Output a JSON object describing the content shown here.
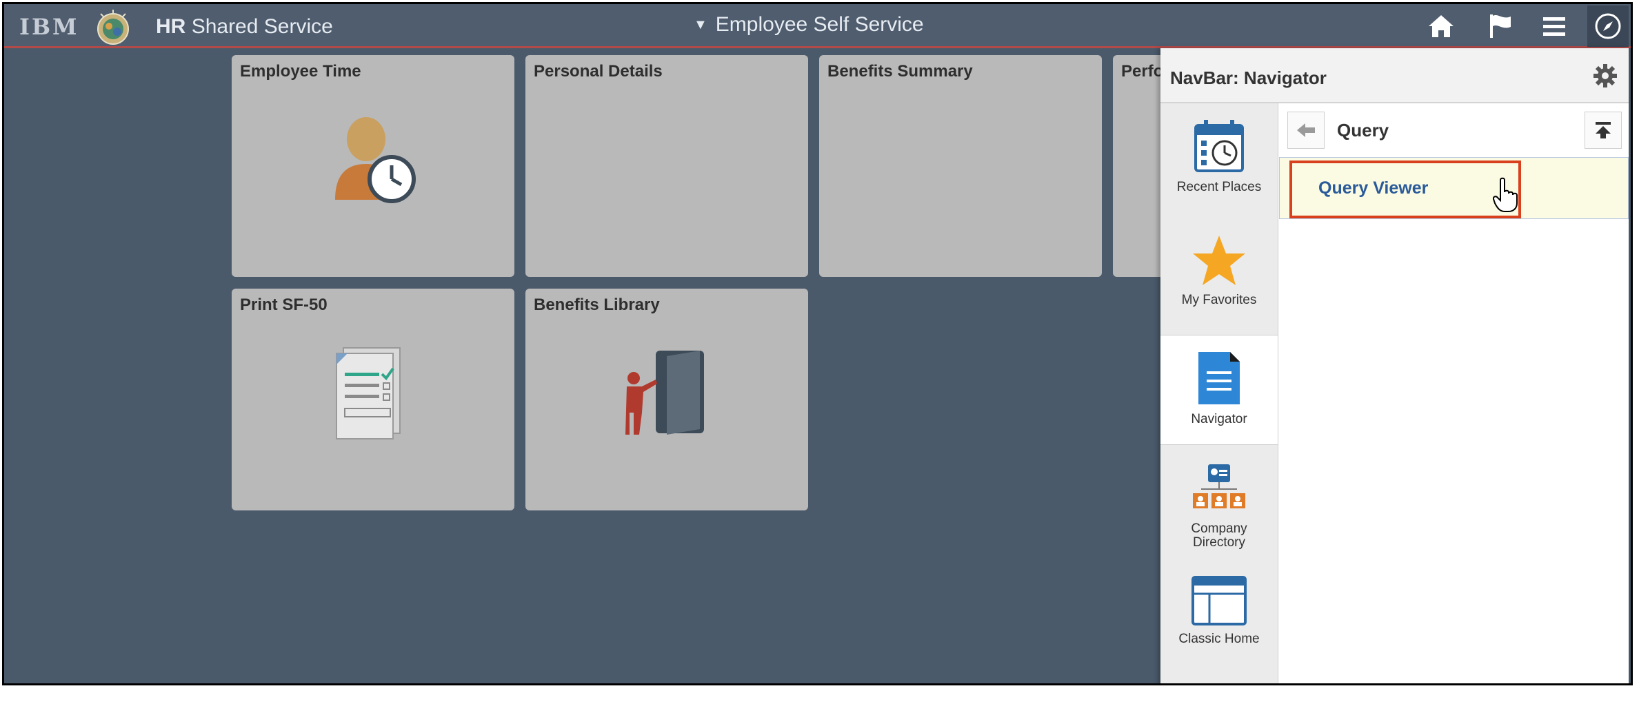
{
  "header": {
    "logo_text": "IBM",
    "app_title_bold": "HR",
    "app_title_rest": "Shared Service",
    "page_title": "Employee Self Service",
    "icons": [
      "globe-logo-icon",
      "home-icon",
      "flag-icon",
      "menu-icon",
      "navigator-compass-icon"
    ]
  },
  "tiles": [
    {
      "title": "Employee Time",
      "icon": "person-clock-icon"
    },
    {
      "title": "Personal Details",
      "icon": ""
    },
    {
      "title": "Benefits Summary",
      "icon": ""
    },
    {
      "title": "Perfo",
      "icon": ""
    },
    {
      "title": "Print SF-50",
      "icon": "checklist-document-icon"
    },
    {
      "title": "Benefits Library",
      "icon": "presenter-door-icon"
    }
  ],
  "navbar": {
    "title": "NavBar: Navigator",
    "rail": [
      {
        "label": "Recent Places",
        "icon": "calendar-clock-icon"
      },
      {
        "label": "My Favorites",
        "icon": "star-icon"
      },
      {
        "label": "Navigator",
        "icon": "document-list-icon"
      },
      {
        "label": "Company Directory",
        "icon": "org-chart-icon"
      },
      {
        "label": "Classic Home",
        "icon": "browser-window-icon"
      }
    ],
    "folder_title": "Query",
    "items": [
      {
        "label": "Query Viewer"
      }
    ]
  },
  "colors": {
    "background": "#4a5a6b",
    "header": "#4f5d6e",
    "header_accent": "#b34a4a",
    "tile": "#b9b9b9",
    "highlight_border": "#d9401d",
    "selected_row": "#fbfbe3",
    "link": "#2a5a9a",
    "star": "#f5a623"
  }
}
